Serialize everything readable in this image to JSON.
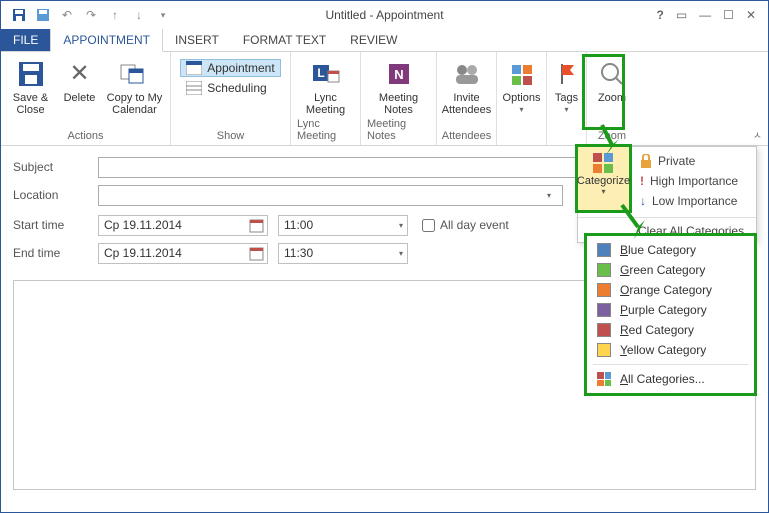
{
  "titlebar": {
    "title": "Untitled - Appointment"
  },
  "tabs": {
    "file": "FILE",
    "appointment": "APPOINTMENT",
    "insert": "INSERT",
    "format_text": "FORMAT TEXT",
    "review": "REVIEW"
  },
  "ribbon": {
    "actions": {
      "save_close": "Save & Close",
      "delete": "Delete",
      "copy_cal": "Copy to My Calendar",
      "label": "Actions"
    },
    "show": {
      "appointment": "Appointment",
      "scheduling": "Scheduling",
      "label": "Show"
    },
    "lync": {
      "btn": "Lync Meeting",
      "label": "Lync Meeting"
    },
    "notes": {
      "btn": "Meeting Notes",
      "label": "Meeting Notes"
    },
    "attendees": {
      "btn": "Invite Attendees",
      "label": "Attendees"
    },
    "options": {
      "btn": "Options",
      "label": ""
    },
    "tags": {
      "btn": "Tags",
      "label": ""
    },
    "zoom": {
      "btn": "Zoom",
      "label": "Zoom"
    }
  },
  "form": {
    "subject_label": "Subject",
    "location_label": "Location",
    "start_label": "Start time",
    "end_label": "End time",
    "start_date": "Cp 19.11.2014",
    "start_time": "11:00",
    "end_date": "Cp 19.11.2014",
    "end_time": "11:30",
    "all_day": "All day event"
  },
  "tagpanel": {
    "categorize": "Categorize",
    "private": "Private",
    "high": "High Importance",
    "low": "Low Importance",
    "clear": "Clear All Categories"
  },
  "catmenu": {
    "blue": "Blue Category",
    "green": "Green Category",
    "orange": "Orange Category",
    "purple": "Purple Category",
    "red": "Red Category",
    "yellow": "Yellow Category",
    "all": "All Categories..."
  },
  "colors": {
    "blue": "#4f81bd",
    "green": "#6abf4b",
    "orange": "#ed7d31",
    "purple": "#7d60a0",
    "red": "#c0504d",
    "yellow": "#ffd54f"
  }
}
